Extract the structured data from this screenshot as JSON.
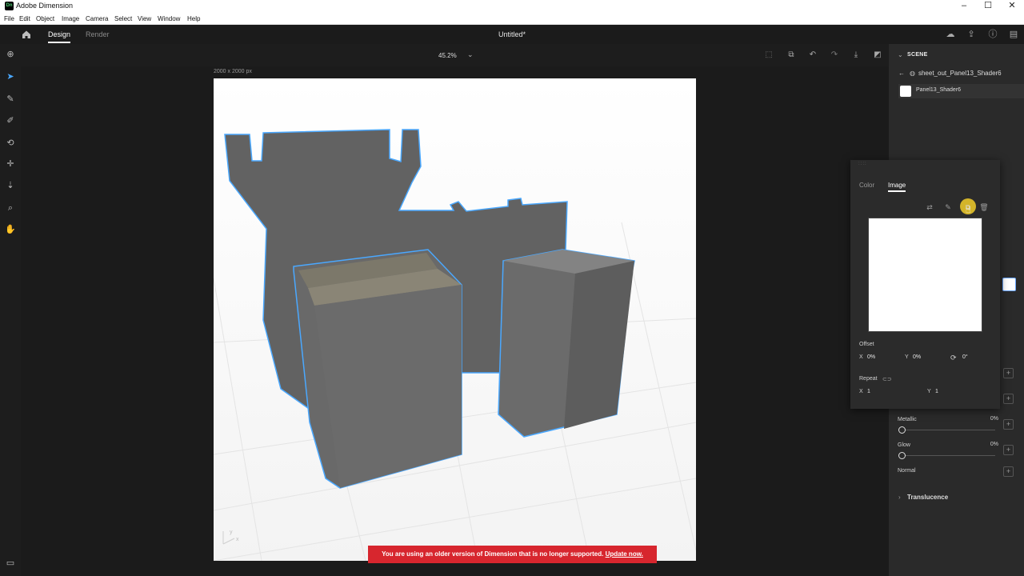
{
  "window": {
    "app_icon": "Dn",
    "title": "Adobe Dimension",
    "controls": {
      "minimize": "–",
      "maximize": "☐",
      "close": "✕"
    }
  },
  "menu": [
    "File",
    "Edit",
    "Object",
    "Image",
    "Camera",
    "Select",
    "View",
    "Window",
    "Help"
  ],
  "header": {
    "tabs": {
      "design": "Design",
      "render": "Render"
    },
    "document_title": "Untitled*"
  },
  "options": {
    "zoom": "45.2%"
  },
  "canvas": {
    "size_label": "2000 x 2000 px",
    "axis_x": "x",
    "axis_y": "y"
  },
  "banner": {
    "message": "You are using an older version of Dimension that is no longer supported.",
    "link": "Update now."
  },
  "scene": {
    "header": "SCENE",
    "parent": "sheet_out_Panel13_Shader6",
    "child": "Panel13_Shader6"
  },
  "properties": {
    "metallic_label": "Metallic",
    "metallic_value": "0%",
    "glow_label": "Glow",
    "glow_value": "0%",
    "normal_label": "Normal",
    "translucence_label": "Translucence",
    "plus": "+"
  },
  "popover": {
    "tab_color": "Color",
    "tab_image": "Image",
    "offset_label": "Offset",
    "offset_x_label": "X",
    "offset_x_value": "0%",
    "offset_y_label": "Y",
    "offset_y_value": "0%",
    "rotation_value": "0°",
    "repeat_label": "Repeat",
    "repeat_x_label": "X",
    "repeat_x_value": "1",
    "repeat_y_label": "Y",
    "repeat_y_value": "1"
  },
  "colors": {
    "accent": "#4aa8ff",
    "banner": "#d7262e",
    "cursor_highlight": "#e6c32a",
    "box_gray": "#6b6b6b"
  }
}
